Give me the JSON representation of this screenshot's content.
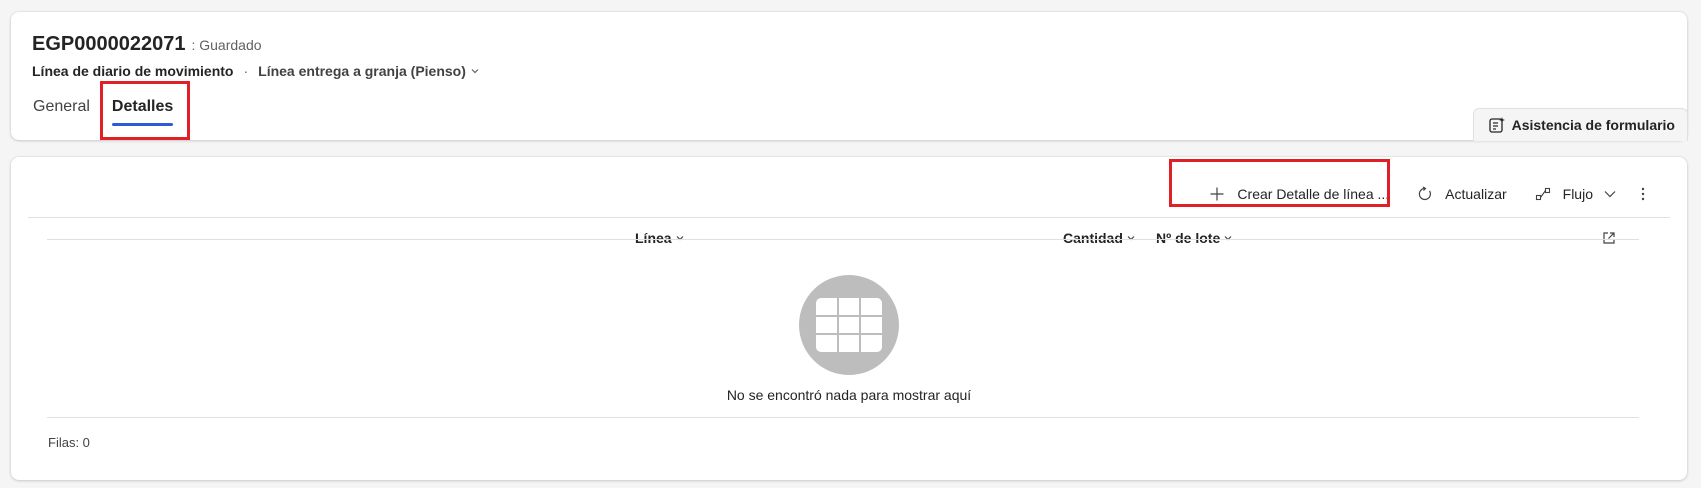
{
  "header": {
    "record_title": "EGP0000022071",
    "record_status": ": Guardado",
    "entity_name": "Línea de diario de movimiento",
    "separator": "·",
    "form_name": "Línea entrega a granja (Pienso)",
    "tabs": [
      {
        "label": "General",
        "active": false
      },
      {
        "label": "Detalles",
        "active": true
      }
    ],
    "form_assist_label": "Asistencia de formulario"
  },
  "subgrid": {
    "commands": {
      "new_label": "Crear Detalle de línea ...",
      "refresh_label": "Actualizar",
      "flow_label": "Flujo"
    },
    "columns": [
      {
        "label": "Línea"
      },
      {
        "label": "Cantidad"
      },
      {
        "label": "Nº de lote"
      }
    ],
    "empty_message": "No se encontró nada para mostrar aquí",
    "rows_label": "Filas: 0"
  },
  "icons": {
    "chevron": "chevron-down-icon",
    "add": "add-icon",
    "refresh": "refresh-icon",
    "flow": "flow-icon",
    "more": "more-vertical-icon",
    "popout": "open-in-new-window-icon",
    "form_assist": "form-assist-icon",
    "empty_grid": "empty-grid-icon"
  },
  "colors": {
    "active_tab_underline": "#2f5bd7",
    "annotation_box": "#e01f26",
    "empty_icon_bg": "#bdbdbd"
  }
}
